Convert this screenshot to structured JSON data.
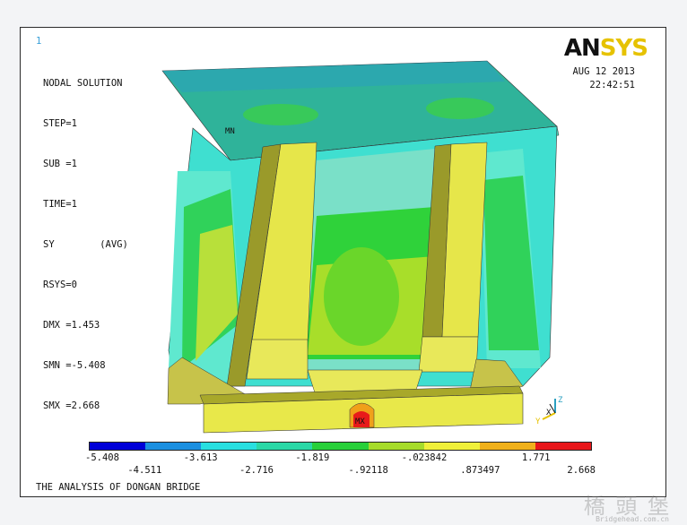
{
  "window_number": "1",
  "logo": {
    "an": "AN",
    "sys": "SYS"
  },
  "info": {
    "line1": "NODAL SOLUTION",
    "line2": "STEP=1",
    "line3": "SUB =1",
    "line4": "TIME=1",
    "line5": "SY        (AVG)",
    "line6": "RSYS=0",
    "line7": "DMX =1.453",
    "line8": "SMN =-5.408",
    "line9": "SMX =2.668"
  },
  "date": "AUG 12 2013",
  "time": "22:42:51",
  "markers": {
    "min": "MN",
    "max": "MX"
  },
  "triad": {
    "x": "X",
    "y": "Y",
    "z": "Z"
  },
  "legend": {
    "colors": [
      "#0000d8",
      "#1a8fe0",
      "#28dfe0",
      "#2ad8a6",
      "#28d03a",
      "#a6dc2a",
      "#f0f03a",
      "#f0b01a",
      "#e8161a"
    ],
    "labels_top": [
      "-5.408",
      "-3.613",
      "-1.819",
      "-.023842",
      "1.771"
    ],
    "labels_bottom": [
      "-4.511",
      "-2.716",
      "-.92118",
      ".873497",
      "2.668"
    ]
  },
  "footer_title": "THE ANALYSIS OF DONGAN BRIDGE",
  "watermark": "橋 頭 堡",
  "watermark_url": "Bridgehead.com.cn"
}
